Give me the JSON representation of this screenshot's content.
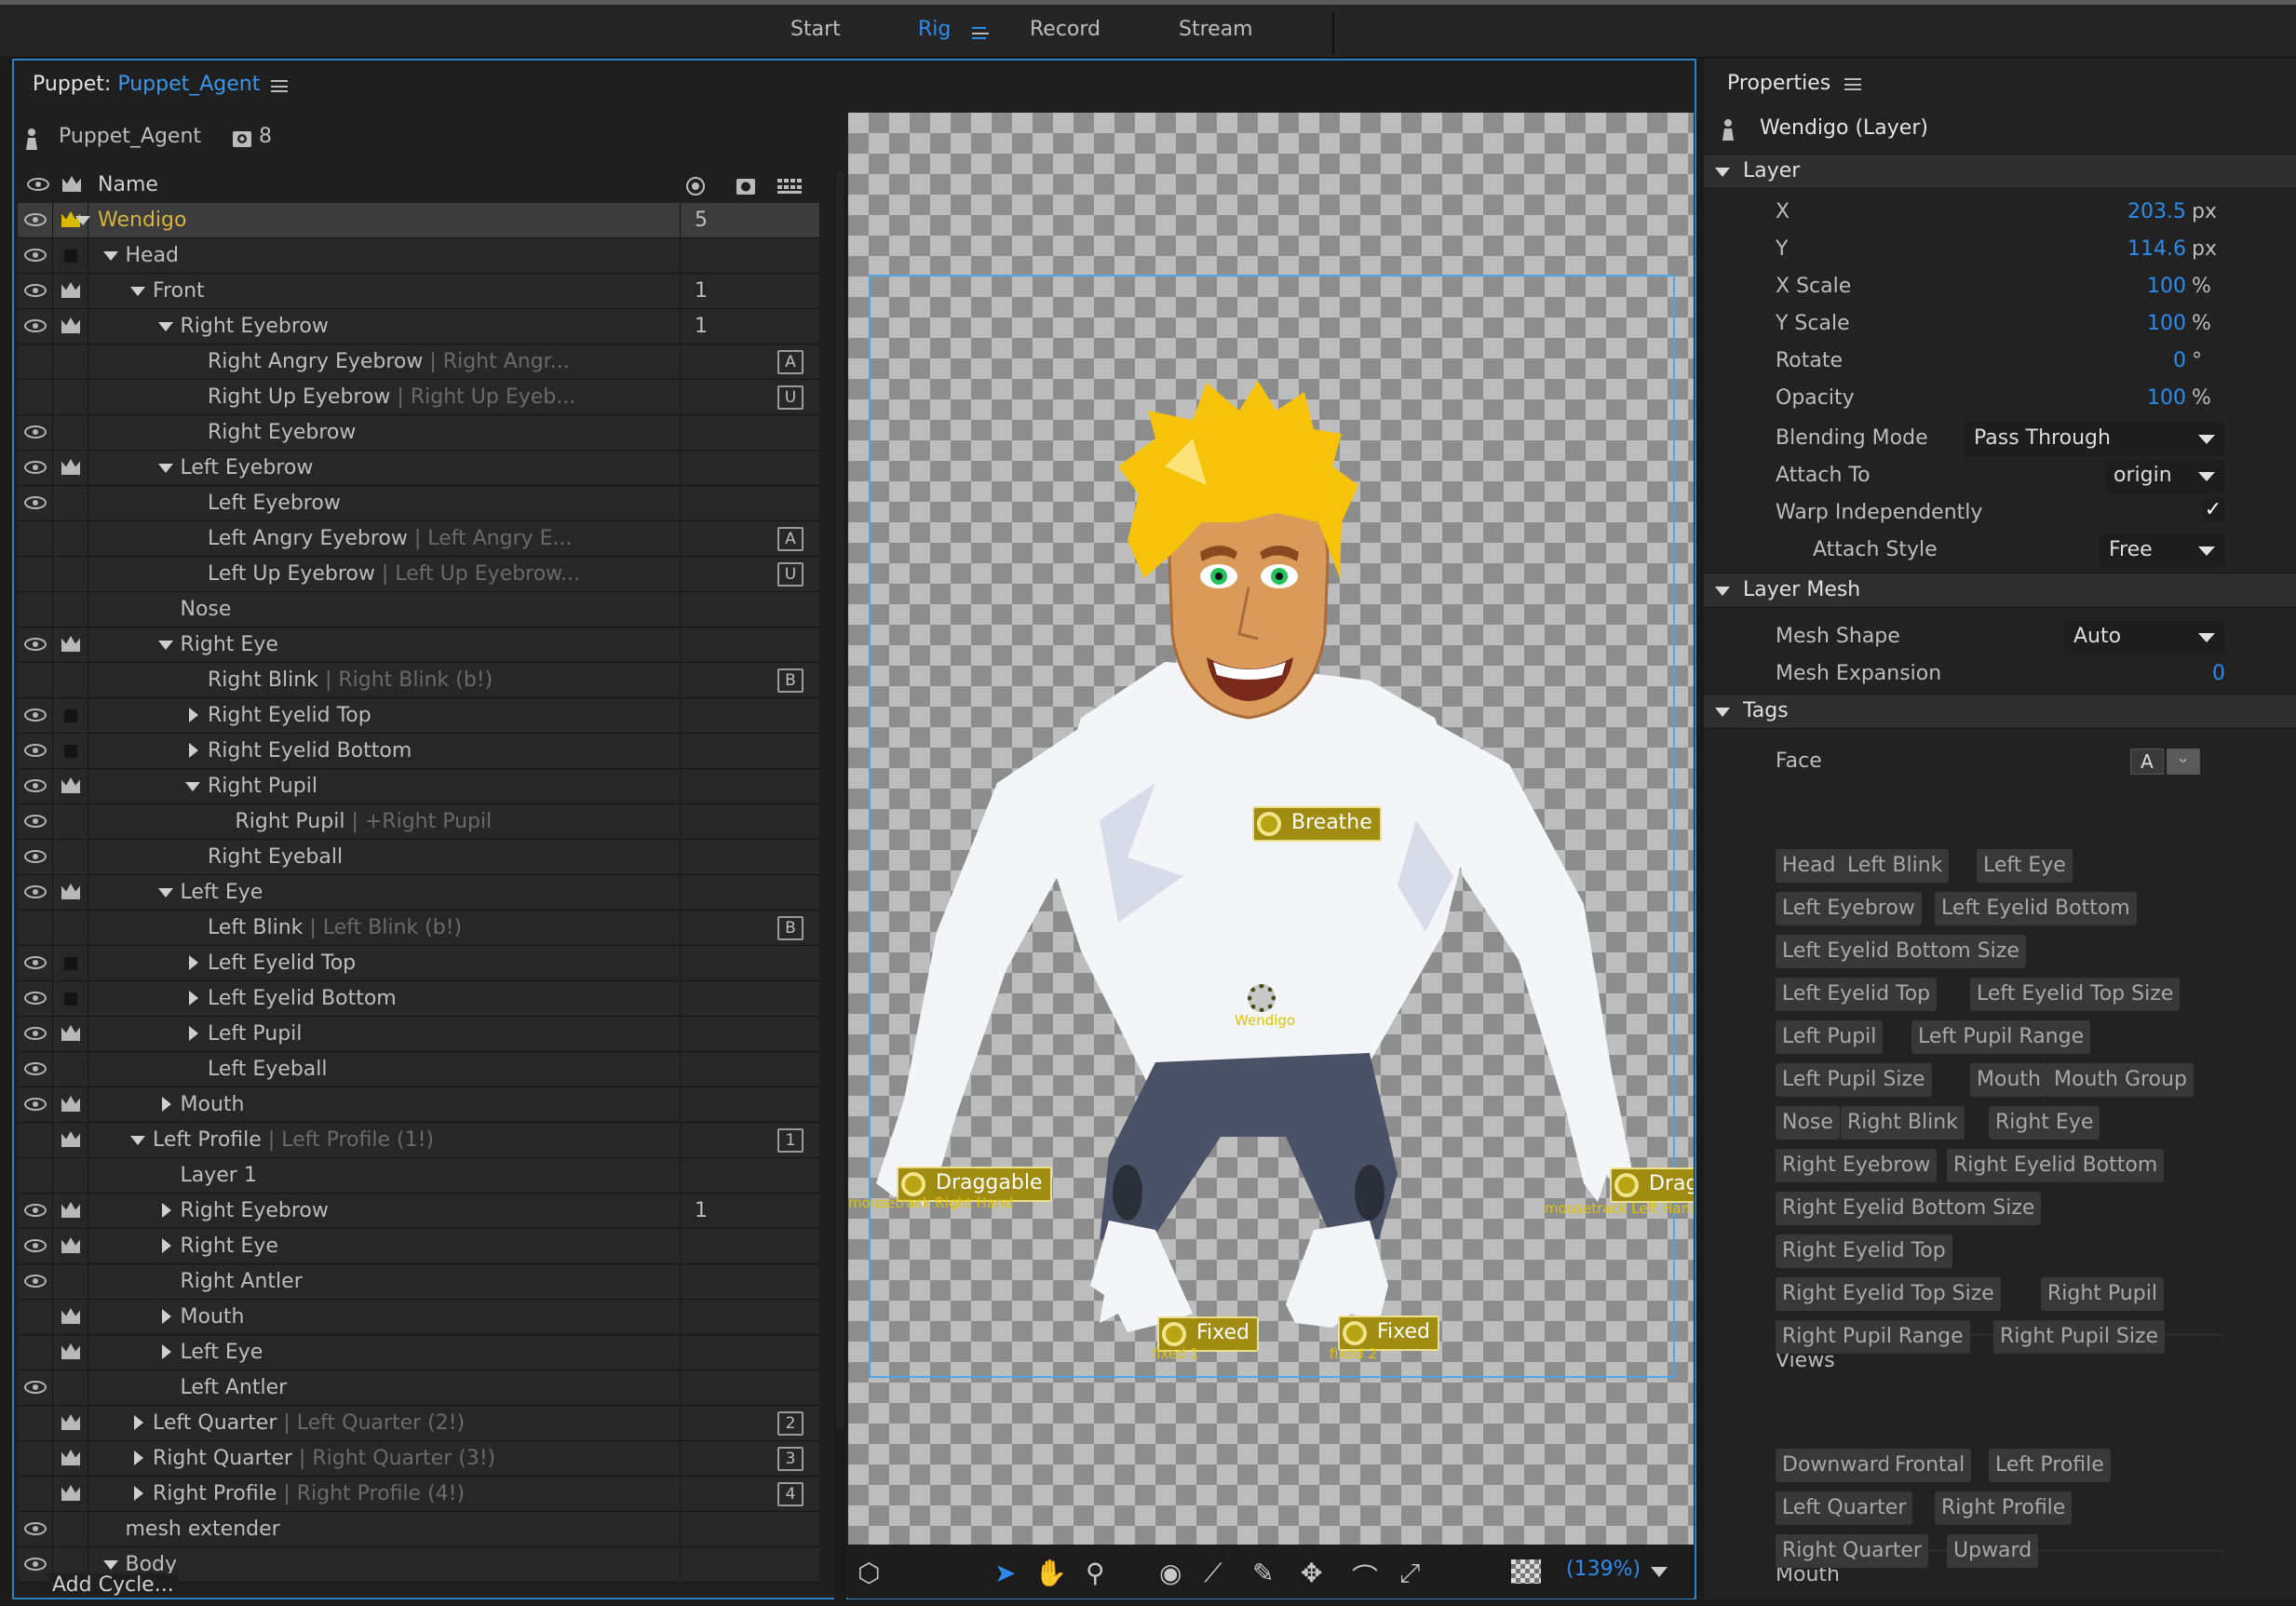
{
  "workspaces": [
    {
      "label": "Start",
      "active": false
    },
    {
      "label": "Rig",
      "active": true
    },
    {
      "label": "Record",
      "active": false
    },
    {
      "label": "Stream",
      "active": false
    }
  ],
  "puppet_panel": {
    "title_prefix": "Puppet:",
    "title_name": "Puppet_Agent",
    "puppet_name": "Puppet_Agent",
    "puppet_count": "8",
    "name_header": "Name",
    "add_cycle": "Add Cycle..."
  },
  "tree_rows": [
    {
      "name": "Wendigo",
      "indent": 0,
      "tri": "down",
      "eye": true,
      "crown": "gold",
      "count": "5",
      "selected": true,
      "gold": true
    },
    {
      "name": "Head",
      "indent": 1,
      "tri": "down",
      "eye": true,
      "crown": "box"
    },
    {
      "name": "Front",
      "indent": 2,
      "tri": "down",
      "eye": true,
      "crown": "crown",
      "count": "1"
    },
    {
      "name": "Right Eyebrow",
      "indent": 3,
      "tri": "down",
      "eye": true,
      "crown": "crown",
      "count": "1"
    },
    {
      "name": "Right Angry Eyebrow",
      "alias": "| Right Angr...",
      "indent": 4,
      "tri": "none",
      "eye": false,
      "crown": "none",
      "key": "A"
    },
    {
      "name": "Right Up Eyebrow",
      "alias": "| Right Up Eyeb...",
      "indent": 4,
      "tri": "none",
      "eye": false,
      "crown": "none",
      "key": "U"
    },
    {
      "name": "Right Eyebrow",
      "indent": 4,
      "tri": "none",
      "eye": true,
      "crown": "none"
    },
    {
      "name": "Left Eyebrow",
      "indent": 3,
      "tri": "down",
      "eye": true,
      "crown": "crown"
    },
    {
      "name": "Left Eyebrow",
      "indent": 4,
      "tri": "none",
      "eye": true,
      "crown": "none"
    },
    {
      "name": "Left Angry Eyebrow",
      "alias": "| Left Angry E...",
      "indent": 4,
      "tri": "none",
      "eye": false,
      "crown": "none",
      "key": "A"
    },
    {
      "name": "Left Up Eyebrow",
      "alias": "| Left Up Eyebrow...",
      "indent": 4,
      "tri": "none",
      "eye": false,
      "crown": "none",
      "key": "U"
    },
    {
      "name": "Nose",
      "indent": 3,
      "tri": "none",
      "eye": false,
      "crown": "none"
    },
    {
      "name": "Right Eye",
      "indent": 3,
      "tri": "down",
      "eye": true,
      "crown": "crown"
    },
    {
      "name": "Right Blink",
      "alias": "| Right Blink (b!)",
      "indent": 4,
      "tri": "none",
      "eye": false,
      "crown": "none",
      "key": "B"
    },
    {
      "name": "Right Eyelid Top",
      "indent": 4,
      "tri": "right",
      "eye": true,
      "crown": "box"
    },
    {
      "name": "Right Eyelid Bottom",
      "indent": 4,
      "tri": "right",
      "eye": true,
      "crown": "box"
    },
    {
      "name": "Right Pupil",
      "indent": 4,
      "tri": "down",
      "eye": true,
      "crown": "crown"
    },
    {
      "name": "Right Pupil",
      "alias": "| +Right Pupil",
      "indent": 5,
      "tri": "none",
      "eye": true,
      "crown": "none"
    },
    {
      "name": "Right Eyeball",
      "indent": 4,
      "tri": "none",
      "eye": true,
      "crown": "none"
    },
    {
      "name": "Left Eye",
      "indent": 3,
      "tri": "down",
      "eye": true,
      "crown": "crown"
    },
    {
      "name": "Left Blink",
      "alias": "| Left Blink (b!)",
      "indent": 4,
      "tri": "none",
      "eye": false,
      "crown": "none",
      "key": "B"
    },
    {
      "name": "Left Eyelid Top",
      "indent": 4,
      "tri": "right",
      "eye": true,
      "crown": "box"
    },
    {
      "name": "Left Eyelid Bottom",
      "indent": 4,
      "tri": "right",
      "eye": true,
      "crown": "box"
    },
    {
      "name": "Left Pupil",
      "indent": 4,
      "tri": "right",
      "eye": true,
      "crown": "crown"
    },
    {
      "name": "Left Eyeball",
      "indent": 4,
      "tri": "none",
      "eye": true,
      "crown": "none"
    },
    {
      "name": "Mouth",
      "indent": 3,
      "tri": "right",
      "eye": true,
      "crown": "crown"
    },
    {
      "name": "Left Profile",
      "alias": "| Left Profile (1!)",
      "indent": 2,
      "tri": "down",
      "eye": false,
      "crown": "crown",
      "key": "1"
    },
    {
      "name": "Layer 1",
      "indent": 3,
      "tri": "none",
      "eye": false,
      "crown": "none"
    },
    {
      "name": "Right Eyebrow",
      "indent": 3,
      "tri": "right",
      "eye": true,
      "crown": "crown",
      "count": "1"
    },
    {
      "name": "Right Eye",
      "indent": 3,
      "tri": "right",
      "eye": true,
      "crown": "crown"
    },
    {
      "name": "Right Antler",
      "indent": 3,
      "tri": "none",
      "eye": true,
      "crown": "none"
    },
    {
      "name": "Mouth",
      "indent": 3,
      "tri": "right",
      "eye": false,
      "crown": "crown"
    },
    {
      "name": "Left Eye",
      "indent": 3,
      "tri": "right",
      "eye": false,
      "crown": "crown"
    },
    {
      "name": "Left Antler",
      "indent": 3,
      "tri": "none",
      "eye": true,
      "crown": "none"
    },
    {
      "name": "Left Quarter",
      "alias": "| Left Quarter (2!)",
      "indent": 2,
      "tri": "right",
      "eye": false,
      "crown": "crown",
      "key": "2"
    },
    {
      "name": "Right Quarter",
      "alias": "| Right Quarter (3!)",
      "indent": 2,
      "tri": "right",
      "eye": false,
      "crown": "crown",
      "key": "3"
    },
    {
      "name": "Right Profile",
      "alias": "| Right Profile (4!)",
      "indent": 2,
      "tri": "right",
      "eye": false,
      "crown": "crown",
      "key": "4"
    },
    {
      "name": "mesh extender",
      "indent": 1,
      "tri": "none",
      "eye": true,
      "crown": "none"
    },
    {
      "name": "Body",
      "indent": 1,
      "tri": "down",
      "eye": true,
      "crown": "none"
    }
  ],
  "canvas": {
    "handles": {
      "breathe": "Breathe",
      "origin": "Wendigo",
      "left_drag": "Draggable",
      "left_drag_sub": "mousetrack Right Hand",
      "right_drag": "Drag",
      "right_drag_sub": "mousetrack Left Hand",
      "fixed1": "Fixed",
      "fixed1_sub": "fixed 1",
      "fixed2": "Fixed",
      "fixed2_sub": "fixed 2"
    },
    "zoom": "(139%)",
    "colors": {
      "hair": "#f7c20a",
      "skin": "#d99a5a",
      "shirt": "#f4f5f8",
      "pants": "#4a5268",
      "eyes": "#22c35a"
    }
  },
  "properties": {
    "title": "Properties",
    "layer_name": "Wendigo (Layer)",
    "layer_section": "Layer",
    "fields": [
      {
        "label": "X",
        "value": "203.5",
        "unit": "px"
      },
      {
        "label": "Y",
        "value": "114.6",
        "unit": "px"
      },
      {
        "label": "X Scale",
        "value": "100",
        "unit": "%"
      },
      {
        "label": "Y Scale",
        "value": "100",
        "unit": "%"
      },
      {
        "label": "Rotate",
        "value": "0",
        "unit": "°"
      },
      {
        "label": "Opacity",
        "value": "100",
        "unit": "%"
      }
    ],
    "blending_label": "Blending Mode",
    "blending_value": "Pass Through",
    "attach_label": "Attach To",
    "attach_value": "origin",
    "warp_label": "Warp Independently",
    "warp_checked": "✓",
    "attach_style_label": "Attach Style",
    "attach_style_value": "Free",
    "mesh_section": "Layer Mesh",
    "mesh_shape_label": "Mesh Shape",
    "mesh_shape_value": "Auto",
    "mesh_exp_label": "Mesh Expansion",
    "mesh_exp_value": "0",
    "tags_section": "Tags",
    "face_label": "Face",
    "face_btn_a": "A",
    "face_btn_b": "ᵕ",
    "face_tags": [
      "Head",
      "Left Blink",
      "Left Eye",
      "Left Eyebrow",
      "Left Eyelid Bottom",
      "Left Eyelid Bottom Size",
      "Left Eyelid Top",
      "Left Eyelid Top Size",
      "Left Pupil",
      "Left Pupil Range",
      "Left Pupil Size",
      "Mouth",
      "Mouth Group",
      "Nose",
      "Right Blink",
      "Right Eye",
      "Right Eyebrow",
      "Right Eyelid Bottom",
      "Right Eyelid Bottom Size",
      "Right Eyelid Top",
      "Right Eyelid Top Size",
      "Right Pupil",
      "Right Pupil Range",
      "Right Pupil Size"
    ],
    "views_label": "Views",
    "view_tags": [
      "Downward",
      "Frontal",
      "Left Profile",
      "Left Quarter",
      "Right Profile",
      "Right Quarter",
      "Upward"
    ],
    "mouth_label": "Mouth"
  }
}
